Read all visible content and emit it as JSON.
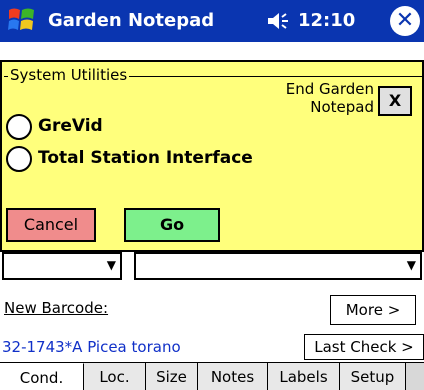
{
  "window": {
    "title": "Garden Notepad",
    "clock": "12:10",
    "close_glyph": "✕",
    "logo_icon": "windows-flag-icon",
    "volume_icon": "speaker-icon"
  },
  "dialog": {
    "group_title": "System Utilities",
    "end_label": "End Garden Notepad",
    "end_button": "X",
    "options": [
      {
        "label": "GreVid",
        "selected": false
      },
      {
        "label": "Total Station Interface",
        "selected": false
      }
    ],
    "cancel_label": "Cancel",
    "go_label": "Go"
  },
  "background": {
    "new_barcode_label": "New Barcode:",
    "more_button": "More >",
    "record_label": "32-1743*A Picea torano",
    "last_check_button": "Last Check >",
    "tabs": [
      "Cond.",
      "Loc.",
      "Size",
      "Notes",
      "Labels",
      "Setup"
    ],
    "active_tab": "Cond."
  },
  "colors": {
    "titlebar": "#0a35b0",
    "dialog_bg": "#ffff7c",
    "cancel_bg": "#f08c8c",
    "go_bg": "#7df08c",
    "record_text": "#1030c8"
  }
}
